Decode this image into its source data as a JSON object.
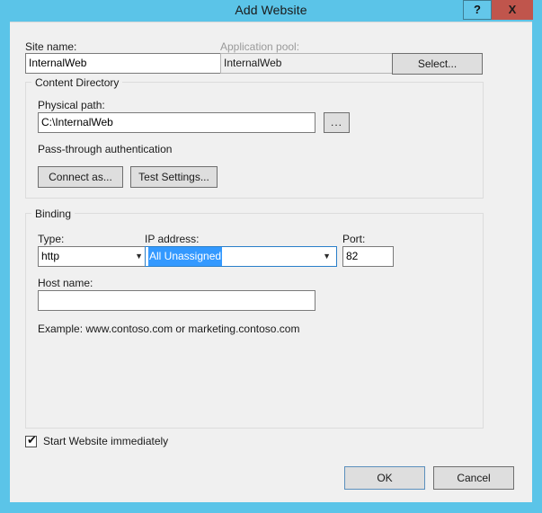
{
  "window": {
    "title": "Add Website",
    "help_label": "?",
    "close_label": "X",
    "titlebar_color": "#5bc4e8",
    "close_button_color": "#c0554c"
  },
  "site": {
    "site_name_label": "Site name:",
    "site_name_value": "InternalWeb",
    "app_pool_label": "Application pool:",
    "app_pool_value": "InternalWeb",
    "select_button_label": "Select..."
  },
  "content_directory": {
    "group_title": "Content Directory",
    "physical_path_label": "Physical path:",
    "physical_path_value": "C:\\InternalWeb",
    "browse_button_label": "...",
    "auth_label": "Pass-through authentication",
    "connect_as_label": "Connect as...",
    "test_settings_label": "Test Settings..."
  },
  "binding": {
    "group_title": "Binding",
    "type_label": "Type:",
    "type_value": "http",
    "ip_label": "IP address:",
    "ip_value": "All Unassigned",
    "port_label": "Port:",
    "port_value": "82",
    "host_label": "Host name:",
    "host_value": "",
    "example_text": "Example: www.contoso.com or marketing.contoso.com",
    "focus_border_color": "#2a7fc9",
    "selection_color": "#3399ff"
  },
  "footer": {
    "start_website_label": "Start Website immediately",
    "start_website_checked": "✔",
    "ok_label": "OK",
    "cancel_label": "Cancel"
  }
}
